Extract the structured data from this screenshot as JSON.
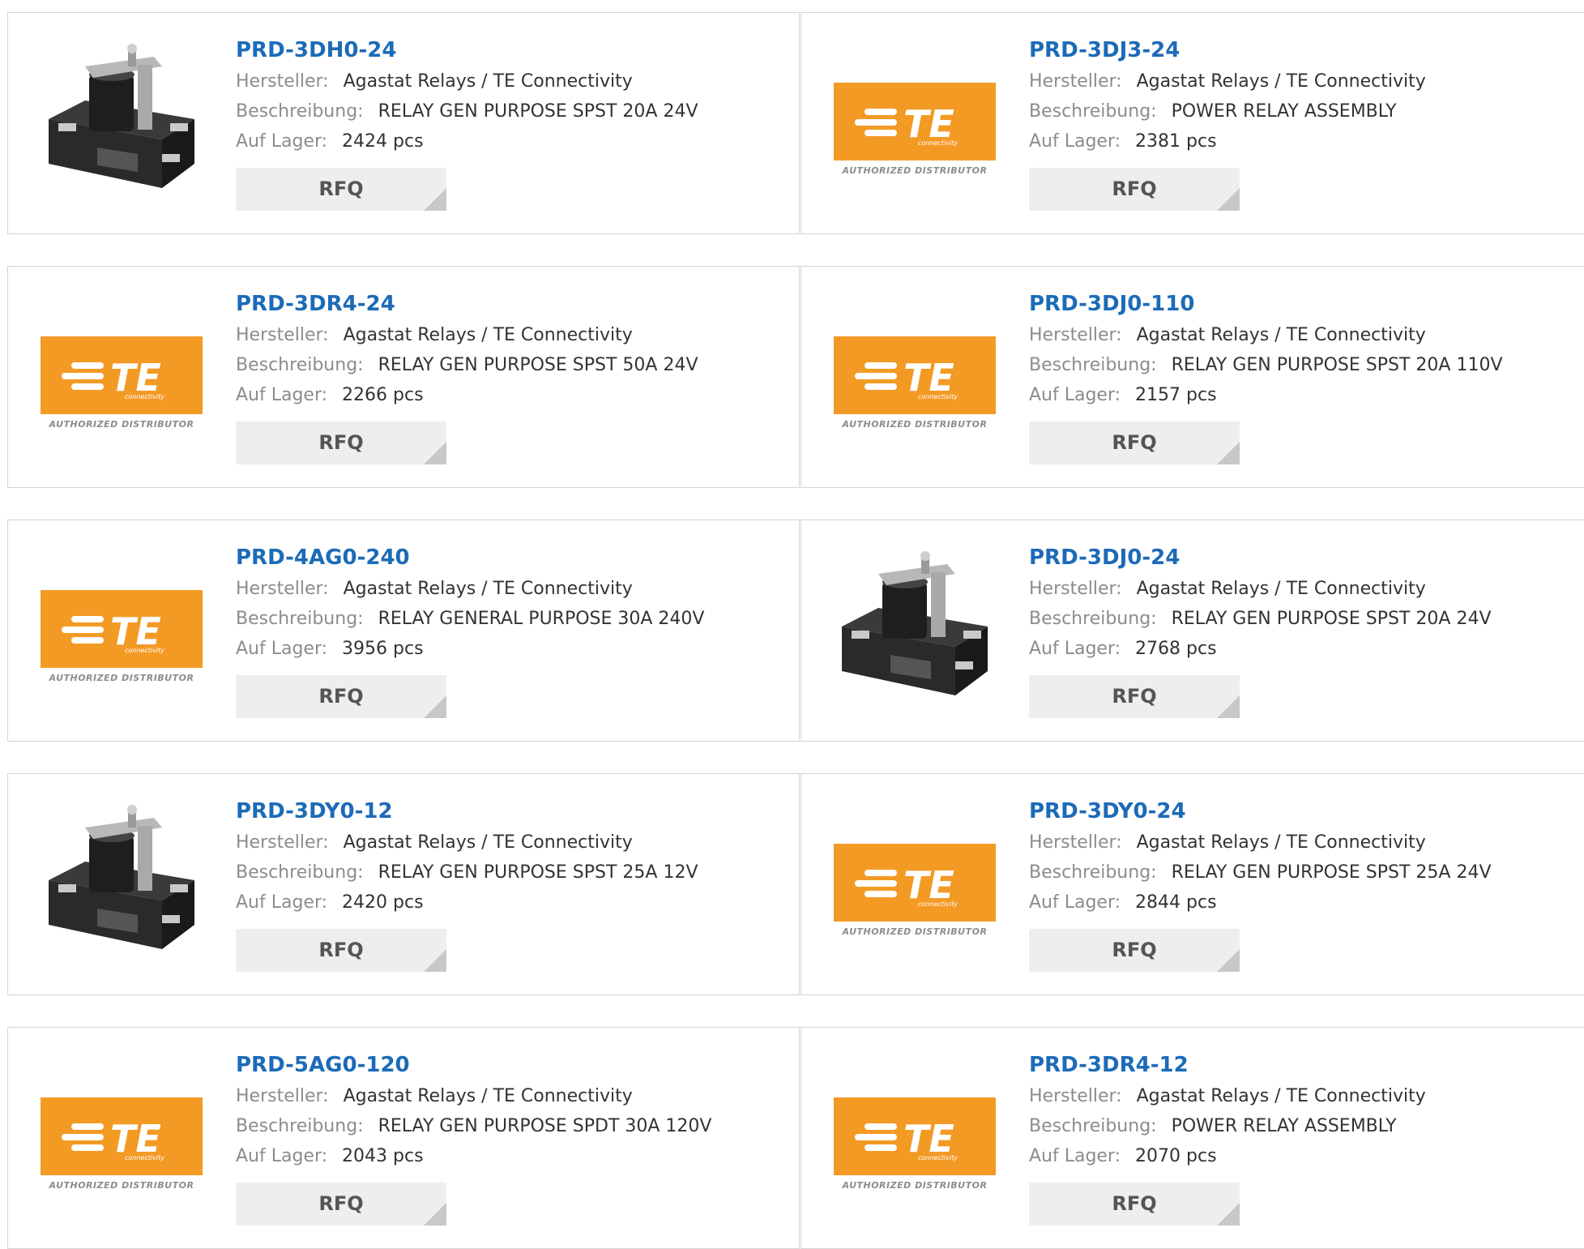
{
  "labels": {
    "manufacturer": "Hersteller:",
    "description": "Beschreibung:",
    "stock": "Auf Lager:",
    "rfq": "RFQ"
  },
  "logo": {
    "caption": "AUTHORIZED DISTRIBUTOR",
    "wordmark": "TE",
    "tagline": "connectivity",
    "brand_color": "#f39a25"
  },
  "colors": {
    "part_number": "#1c6bb8",
    "label": "#8c8c8c",
    "value": "#333333",
    "border": "#d4d4d4",
    "rfq_bg": "#eeeeee"
  },
  "products": [
    {
      "part": "PRD-3DH0-24",
      "manufacturer": "Agastat Relays / TE Connectivity",
      "description": "RELAY GEN PURPOSE SPST 20A 24V",
      "stock": "2424 pcs",
      "image": "relay-photo-icon"
    },
    {
      "part": "PRD-3DJ3-24",
      "manufacturer": "Agastat Relays / TE Connectivity",
      "description": "POWER RELAY ASSEMBLY",
      "stock": "2381 pcs",
      "image": "te-logo"
    },
    {
      "part": "PRD-3DR4-24",
      "manufacturer": "Agastat Relays / TE Connectivity",
      "description": "RELAY GEN PURPOSE SPST 50A 24V",
      "stock": "2266 pcs",
      "image": "te-logo"
    },
    {
      "part": "PRD-3DJ0-110",
      "manufacturer": "Agastat Relays / TE Connectivity",
      "description": "RELAY GEN PURPOSE SPST 20A 110V",
      "stock": "2157 pcs",
      "image": "te-logo"
    },
    {
      "part": "PRD-4AG0-240",
      "manufacturer": "Agastat Relays / TE Connectivity",
      "description": "RELAY GENERAL PURPOSE 30A 240V",
      "stock": "3956 pcs",
      "image": "te-logo"
    },
    {
      "part": "PRD-3DJ0-24",
      "manufacturer": "Agastat Relays / TE Connectivity",
      "description": "RELAY GEN PURPOSE SPST 20A 24V",
      "stock": "2768 pcs",
      "image": "relay-photo-icon"
    },
    {
      "part": "PRD-3DY0-12",
      "manufacturer": "Agastat Relays / TE Connectivity",
      "description": "RELAY GEN PURPOSE SPST 25A 12V",
      "stock": "2420 pcs",
      "image": "relay-photo-icon"
    },
    {
      "part": "PRD-3DY0-24",
      "manufacturer": "Agastat Relays / TE Connectivity",
      "description": "RELAY GEN PURPOSE SPST 25A 24V",
      "stock": "2844 pcs",
      "image": "te-logo"
    },
    {
      "part": "PRD-5AG0-120",
      "manufacturer": "Agastat Relays / TE Connectivity",
      "description": "RELAY GEN PURPOSE SPDT 30A 120V",
      "stock": "2043 pcs",
      "image": "te-logo"
    },
    {
      "part": "PRD-3DR4-12",
      "manufacturer": "Agastat Relays / TE Connectivity",
      "description": "POWER RELAY ASSEMBLY",
      "stock": "2070 pcs",
      "image": "te-logo"
    }
  ]
}
